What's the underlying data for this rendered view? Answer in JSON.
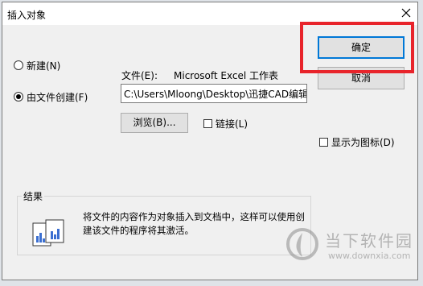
{
  "dialog": {
    "title": "插入对象",
    "option_new": "新建(N)",
    "option_from_file": "由文件创建(F)",
    "file_label": "文件(E):",
    "file_type": "Microsoft Excel 工作表",
    "file_path": "C:\\Users\\Mloong\\Desktop\\迅捷CAD编辑",
    "browse_label": "浏览(B)...",
    "link_label": "链接(L)",
    "ok_label": "确定",
    "cancel_label": "取消",
    "display_as_icon_label": "显示为图标(D)",
    "result_label": "结果",
    "result_text": "将文件的内容作为对象插入到文档中，这样可以使用创建该文件的程序将其激活。"
  },
  "watermark": {
    "brand": "当下软件园",
    "url": "www.downxia.com"
  }
}
